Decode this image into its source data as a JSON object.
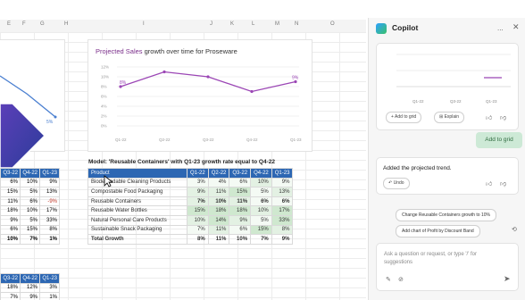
{
  "column_letters": [
    "E",
    "F",
    "G",
    "H",
    "I",
    "J",
    "K",
    "L",
    "M",
    "N",
    "O"
  ],
  "chart": {
    "title_highlight": "Projected Sales",
    "title_rest": " growth over time for Proseware",
    "y_ticks": [
      "12%",
      "10%",
      "8%",
      "6%",
      "4%",
      "2%",
      "0%"
    ],
    "x_ticks": [
      "Q1-22",
      "Q2-22",
      "Q3-22",
      "Q4-22",
      "Q1-23"
    ],
    "first_label": "8%",
    "last_label": "9%"
  },
  "chart_data": {
    "type": "line",
    "categories": [
      "Q1-22",
      "Q2-22",
      "Q3-22",
      "Q4-22",
      "Q1-23"
    ],
    "values": [
      8,
      11,
      10,
      7,
      9
    ],
    "title": "Projected Sales growth over time for Proseware",
    "ylim": [
      0,
      12
    ],
    "first_point_label": "8%",
    "last_point_label": "9%"
  },
  "left_chart": {
    "label": "5%"
  },
  "model_label": "Model: 'Reusable Containers' with Q1-23 growth rate equal to Q4-22",
  "table": {
    "headers": [
      "Product",
      "Q1-22",
      "Q2-22",
      "Q3-22",
      "Q4-22",
      "Q1-23"
    ],
    "rows": [
      [
        "Biodegradable Cleaning Products",
        "3%",
        "4%",
        "6%",
        "10%",
        "9%"
      ],
      [
        "Compostable Food Packaging",
        "9%",
        "11%",
        "15%",
        "5%",
        "13%"
      ],
      [
        "Reusable Containers",
        "7%",
        "10%",
        "11%",
        "6%",
        "6%"
      ],
      [
        "Reusable Water Bottles",
        "15%",
        "18%",
        "18%",
        "10%",
        "17%"
      ],
      [
        "Natural Personal Care Products",
        "10%",
        "14%",
        "9%",
        "5%",
        "33%"
      ],
      [
        "Sustainable Snack Packaging",
        "7%",
        "11%",
        "6%",
        "15%",
        "8%"
      ],
      [
        "Total Growth",
        "8%",
        "11%",
        "10%",
        "7%",
        "9%"
      ]
    ]
  },
  "left_table": {
    "headers": [
      "Q3-22",
      "Q4-22",
      "Q1-23"
    ],
    "rows": [
      [
        "6%",
        "10%",
        "9%"
      ],
      [
        "15%",
        "5%",
        "13%"
      ],
      [
        "11%",
        "6%",
        "-9%"
      ],
      [
        "18%",
        "10%",
        "17%"
      ],
      [
        "9%",
        "5%",
        "33%"
      ],
      [
        "6%",
        "15%",
        "8%"
      ],
      [
        "10%",
        "7%",
        "1%"
      ]
    ]
  },
  "left_table2": {
    "headers": [
      "Q3-22",
      "Q4-22",
      "Q1-23"
    ],
    "rows": [
      [
        "18%",
        "12%",
        "3%"
      ],
      [
        "7%",
        "9%",
        "1%"
      ]
    ]
  },
  "copilot": {
    "title": "Copilot",
    "more": "...",
    "close": "✕",
    "mini_ticks": [
      "Q1-22",
      "Q3-22",
      "Q1-23"
    ],
    "add_to_grid": "+ Add to grid",
    "explain": "Explain",
    "user_message": "Add to grid",
    "response_text": "Added the projected trend.",
    "undo": "Undo",
    "suggestion_1": "Change Reusable Containers growth to 10%",
    "suggestion_2": "Add chart of Profit by Discount Band",
    "input_placeholder": "Ask a question or request, or type '/' for suggestions"
  },
  "colors": {
    "accent": "#2d67b3",
    "line": "#9b46b5",
    "arrow": "#4b3fa8"
  }
}
